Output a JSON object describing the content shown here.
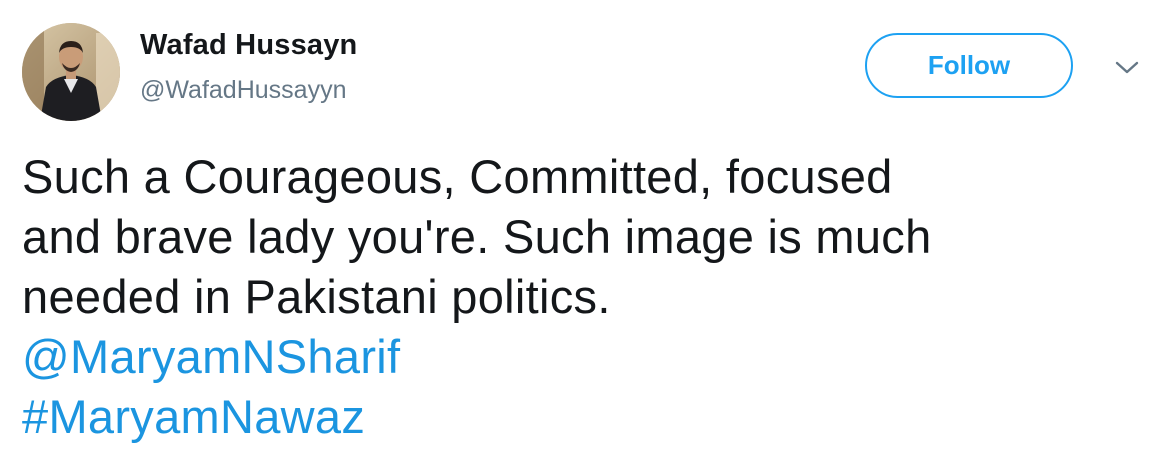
{
  "author": {
    "display_name": "Wafad Hussayn",
    "handle": "@WafadHussayyn"
  },
  "follow_button": {
    "label": "Follow"
  },
  "menu": {
    "icon": "chevron-down-icon"
  },
  "tweet": {
    "lines": [
      "Such a Courageous, Committed, focused",
      "and brave lady you're. Such image is much",
      "needed in Pakistani politics."
    ],
    "mention": "@MaryamNSharif",
    "hashtag": "#MaryamNawaz"
  },
  "colors": {
    "accent": "#1da1f2",
    "link": "#1b95e0",
    "text": "#14171a",
    "secondary_text": "#657786"
  }
}
